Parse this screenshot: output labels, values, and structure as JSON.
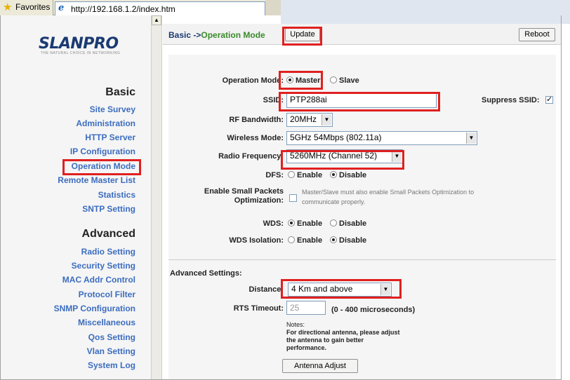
{
  "browser": {
    "favorites_label": "Favorites",
    "url": "http://192.168.1.2/index.htm"
  },
  "logo": {
    "text": "SLANPRO",
    "tagline": "THE NATURAL CHOICE IN NETWORKING"
  },
  "sidebar": {
    "basic_title": "Basic",
    "basic_items": [
      "Site Survey",
      "Administration",
      "HTTP Server",
      "IP Configuration",
      "Operation Mode",
      "Remote Master List",
      "Statistics",
      "SNTP Setting"
    ],
    "advanced_title": "Advanced",
    "advanced_items": [
      "Radio Setting",
      "Security Setting",
      "MAC Addr Control",
      "Protocol Filter",
      "SNMP Configuration",
      "Miscellaneous",
      "Qos Setting",
      "Vlan Setting",
      "System Log"
    ]
  },
  "header": {
    "breadcrumb_prefix": "Basic ->",
    "breadcrumb_page": "Operation Mode",
    "update_label": "Update",
    "reboot_label": "Reboot"
  },
  "form": {
    "operation_mode": {
      "label": "Operation Mode:",
      "options": [
        "Master",
        "Slave"
      ],
      "selected": "Master"
    },
    "ssid": {
      "label": "SSID:",
      "value": "PTP288ai"
    },
    "suppress_ssid": {
      "label": "Suppress SSID:",
      "checked": true
    },
    "rf_bandwidth": {
      "label": "RF Bandwidth:",
      "value": "20MHz"
    },
    "wireless_mode": {
      "label": "Wireless Mode:",
      "value": "5GHz 54Mbps (802.11a)"
    },
    "radio_frequency": {
      "label": "Radio Frequency:",
      "value": "5260MHz (Channel 52)"
    },
    "dfs": {
      "label": "DFS:",
      "options": [
        "Enable",
        "Disable"
      ],
      "selected": "Disable"
    },
    "small_packets": {
      "label_line1": "Enable Small Packets",
      "label_line2": "Optimization:",
      "checked": false,
      "hint_line1": "Master/Slave must also enable Small Packets Optimization to",
      "hint_line2": "communicate properly."
    },
    "wds": {
      "label": "WDS:",
      "options": [
        "Enable",
        "Disable"
      ],
      "selected": "Enable"
    },
    "wds_isolation": {
      "label": "WDS Isolation:",
      "options": [
        "Enable",
        "Disable"
      ],
      "selected": "Disable"
    }
  },
  "advanced": {
    "title": "Advanced Settings:",
    "distance": {
      "label": "Distance:",
      "value": "4 Km and above"
    },
    "rts_timeout": {
      "label": "RTS Timeout:",
      "value": "25",
      "range": "(0 - 400 microseconds)"
    },
    "notes": [
      "Notes:",
      "For directional antenna, please adjust",
      "the antenna to gain better",
      "performance."
    ],
    "antenna_adjust_label": "Antenna Adjust"
  },
  "colors": {
    "highlight": "#e02020",
    "nav_link": "#3c6dbf",
    "breadcrumb": "#1a3a72",
    "breadcrumb_page": "#3a8a2a"
  }
}
